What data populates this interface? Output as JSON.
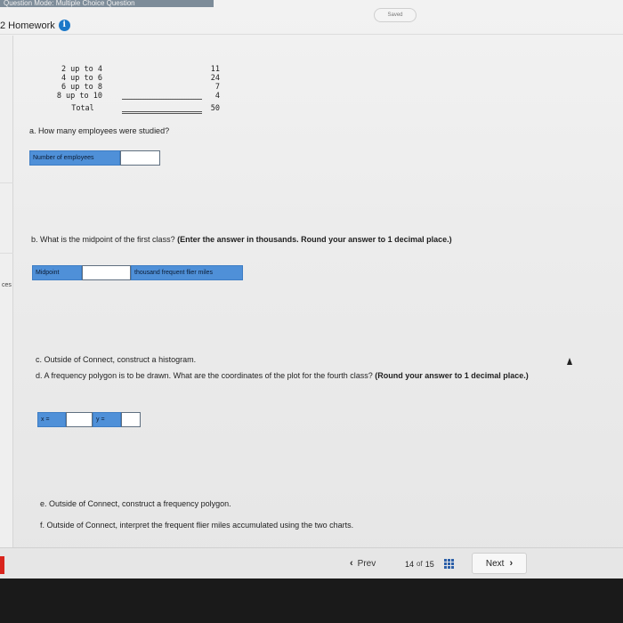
{
  "top_strip": "Question Mode: Multiple Choice Question",
  "header": {
    "homework": "2 Homework",
    "info_icon": "i",
    "saved": "Saved"
  },
  "left_rail": {
    "label": "ces"
  },
  "table": {
    "rows": [
      {
        "class": "2 up to 4",
        "freq": "11"
      },
      {
        "class": "4 up to 6",
        "freq": "24"
      },
      {
        "class": "6 up to 8",
        "freq": "7"
      },
      {
        "class": "8 up to 10",
        "freq": "4"
      },
      {
        "class": "Total",
        "freq": "50"
      }
    ]
  },
  "questions": {
    "a": {
      "text": "a. How many employees were studied?",
      "field_label": "Number of employees",
      "value": ""
    },
    "b": {
      "text": "b. What is the midpoint of the first class?",
      "instruction": "(Enter the answer in thousands. Round your answer to 1 decimal place.)",
      "field_label": "Midpoint",
      "unit": "thousand frequent flier miles",
      "value": ""
    },
    "c": {
      "text": "c. Outside of Connect, construct a histogram."
    },
    "d": {
      "text": "d. A frequency polygon is to be drawn. What are the coordinates of the plot for the fourth class?",
      "instruction": "(Round your answer to 1 decimal place.)",
      "x_label": "x =",
      "y_label": "y =",
      "x_value": "",
      "y_value": ""
    },
    "e": {
      "text": "e. Outside of Connect, construct a frequency polygon."
    },
    "f": {
      "text": "f. Outside of Connect, interpret the frequent flier miles accumulated using the two charts."
    }
  },
  "nav": {
    "prev": "Prev",
    "page_current": "14",
    "page_of": "of",
    "page_total": "15",
    "next": "Next",
    "prev_icon": "chevron-left-icon",
    "next_icon": "chevron-right-icon",
    "grid_icon": "grid-icon"
  },
  "colors": {
    "accent": "#4f90d8",
    "info": "#1b78c8",
    "red_tab": "#d9241c"
  }
}
